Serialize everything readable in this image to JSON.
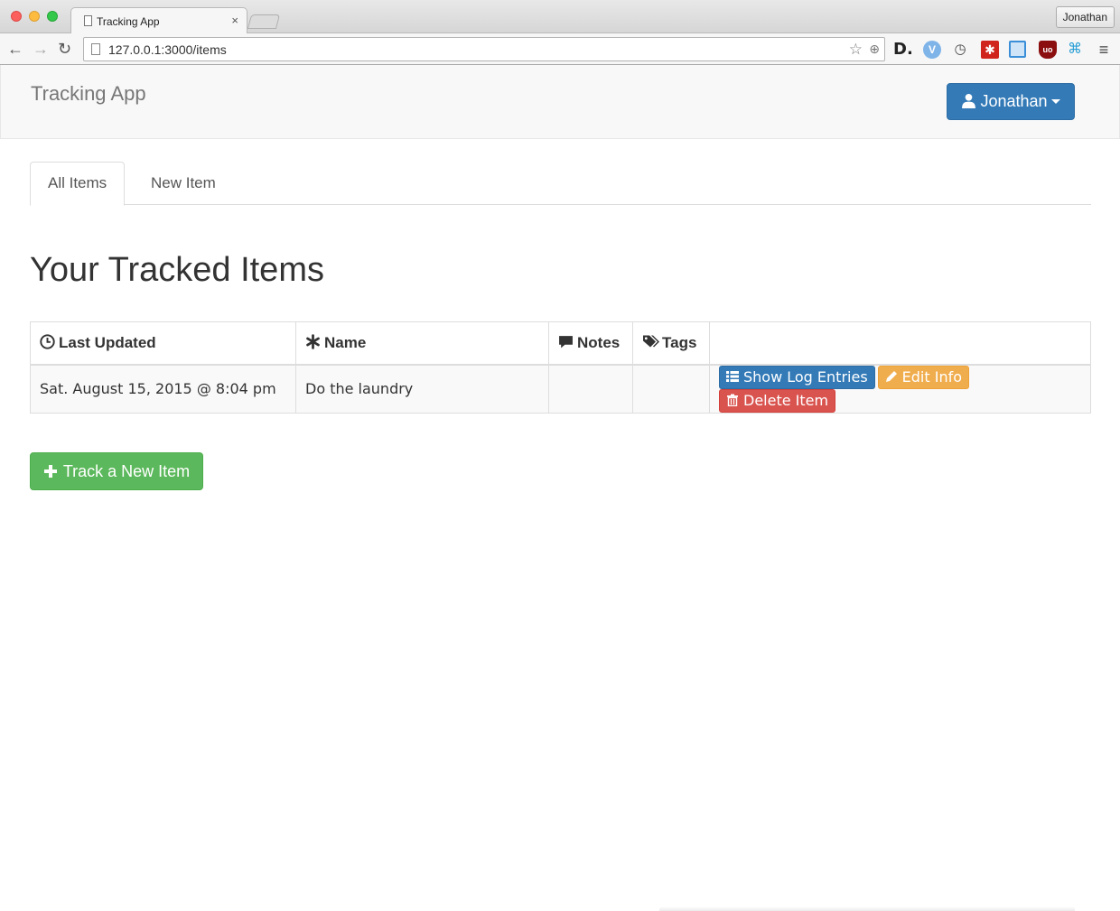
{
  "browser": {
    "tab_title": "Tracking App",
    "tab_close": "×",
    "profile_name": "Jonathan",
    "url": "127.0.0.1:3000/items",
    "back": "←",
    "forward": "→",
    "reload": "↻",
    "star": "☆",
    "zoom": "⊕",
    "extensions": {
      "d": "D.",
      "v": "V",
      "clock": "◷",
      "asterisk": "✱",
      "shield": "uo",
      "network": "⌘",
      "menu": "≡"
    }
  },
  "navbar": {
    "brand": "Tracking App",
    "user_button": "Jonathan"
  },
  "tabs": [
    {
      "label": "All Items",
      "active": true
    },
    {
      "label": "New Item",
      "active": false
    }
  ],
  "page_title": "Your Tracked Items",
  "table": {
    "headers": {
      "last_updated": "Last Updated",
      "name": "Name",
      "notes": "Notes",
      "tags": "Tags"
    },
    "rows": [
      {
        "last_updated": "Sat. August 15, 2015 @ 8:04 pm",
        "name": "Do the laundry",
        "notes": "",
        "tags": ""
      }
    ],
    "actions": {
      "show_log": "Show Log Entries",
      "edit": "Edit Info",
      "delete": "Delete Item"
    }
  },
  "track_button": "Track a New Item",
  "colors": {
    "primary": "#337ab7",
    "success": "#5cb85c",
    "warning": "#f0ad4e",
    "danger": "#d9534f"
  }
}
